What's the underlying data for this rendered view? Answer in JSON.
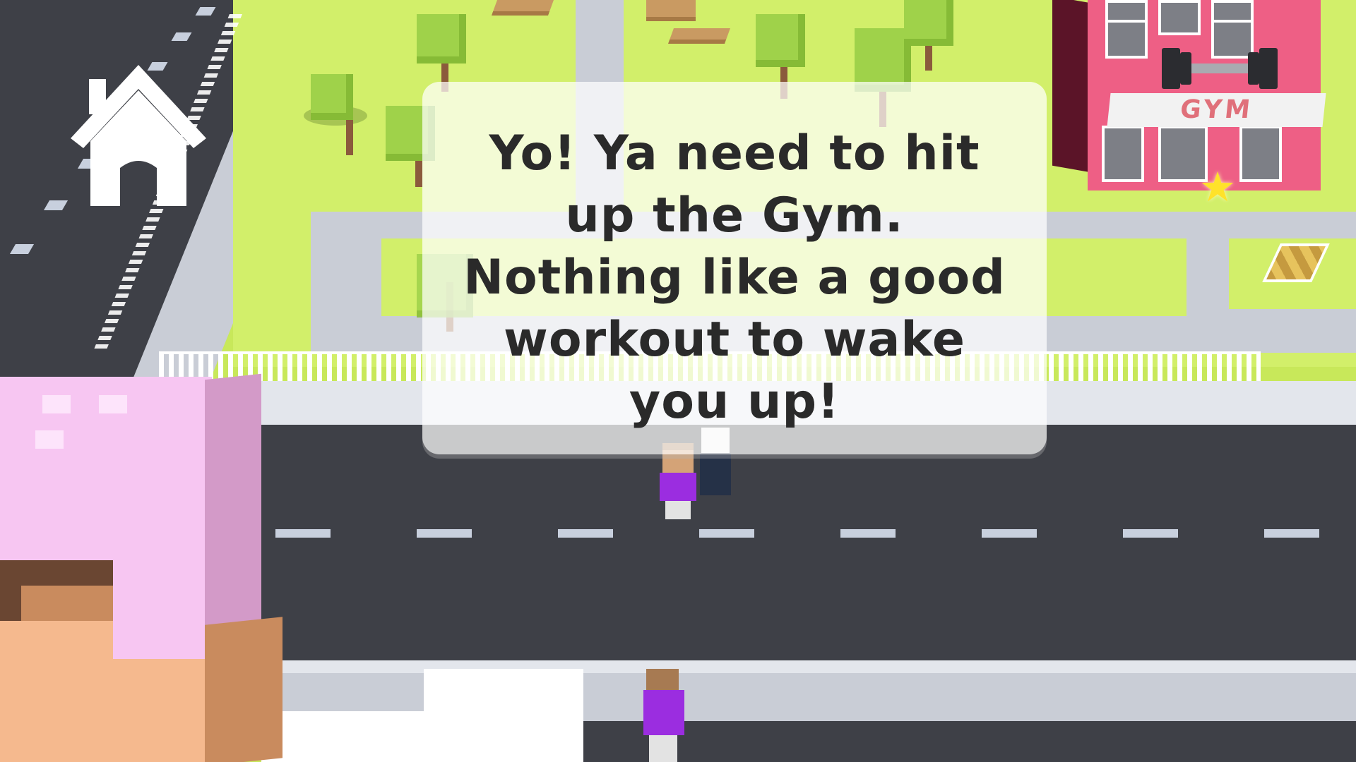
{
  "scene": {
    "building_sign": "GYM",
    "marker_icon": "star-icon",
    "colors": {
      "grass": "#d2ef6a",
      "road": "#3e4047",
      "sidewalk": "#c9cdd6",
      "gym_wall": "#ee5f85",
      "hair": "#f7c6f2",
      "player_shirt": "#9b2de0"
    }
  },
  "hud": {
    "home_button_icon": "home-icon"
  },
  "dialog": {
    "lines": [
      "Yo!  Ya need to hit",
      "up the Gym.",
      "Nothing like a good",
      "workout to wake",
      "you up!"
    ]
  }
}
